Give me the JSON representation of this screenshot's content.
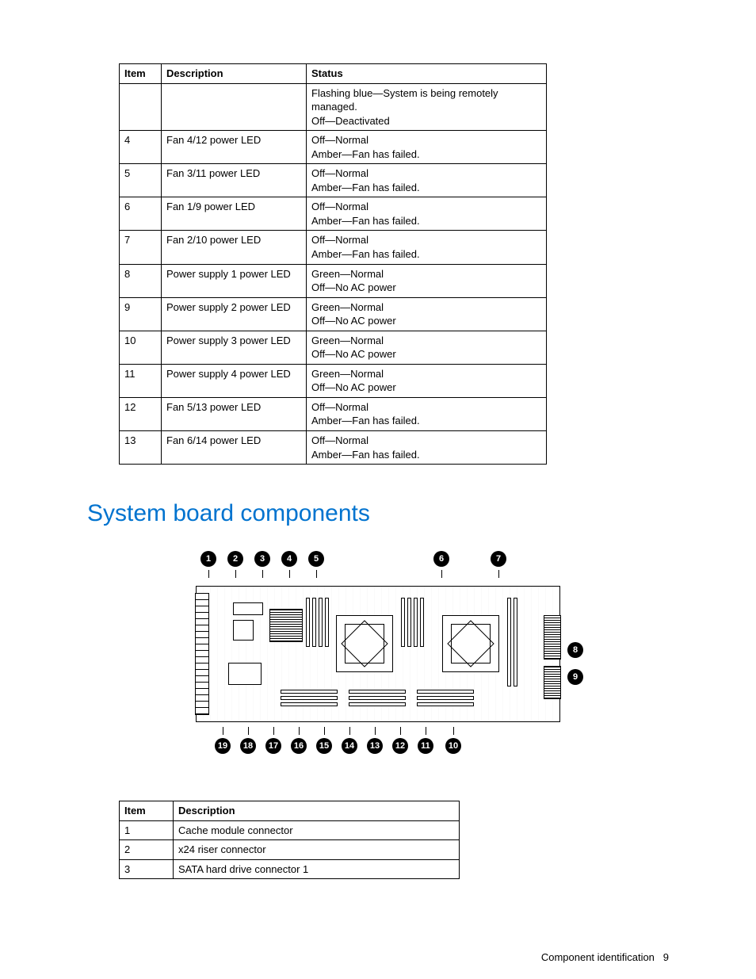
{
  "led_table": {
    "headers": [
      "Item",
      "Description",
      "Status"
    ],
    "rows": [
      {
        "item": "",
        "description": "",
        "status": "Flashing blue—System is being remotely managed.\nOff—Deactivated"
      },
      {
        "item": "4",
        "description": "Fan 4/12 power LED",
        "status": "Off—Normal\nAmber—Fan has failed."
      },
      {
        "item": "5",
        "description": "Fan 3/11 power LED",
        "status": "Off—Normal\nAmber—Fan has failed."
      },
      {
        "item": "6",
        "description": "Fan 1/9 power LED",
        "status": "Off—Normal\nAmber—Fan has failed."
      },
      {
        "item": "7",
        "description": "Fan 2/10 power LED",
        "status": "Off—Normal\nAmber—Fan has failed."
      },
      {
        "item": "8",
        "description": "Power supply 1 power LED",
        "status": "Green—Normal\nOff—No AC power"
      },
      {
        "item": "9",
        "description": "Power supply 2 power LED",
        "status": "Green—Normal\nOff—No AC power"
      },
      {
        "item": "10",
        "description": "Power supply 3 power LED",
        "status": "Green—Normal\nOff—No AC power"
      },
      {
        "item": "11",
        "description": "Power supply 4 power LED",
        "status": "Green—Normal\nOff—No AC power"
      },
      {
        "item": "12",
        "description": "Fan 5/13 power LED",
        "status": "Off—Normal\nAmber—Fan has failed."
      },
      {
        "item": "13",
        "description": "Fan 6/14 power LED",
        "status": "Off—Normal\nAmber—Fan has failed."
      }
    ]
  },
  "section_heading": "System board components",
  "diagram": {
    "top_callouts": [
      "1",
      "2",
      "3",
      "4",
      "5",
      "6",
      "7"
    ],
    "side_callouts": [
      "8",
      "9"
    ],
    "bottom_callouts": [
      "19",
      "18",
      "17",
      "16",
      "15",
      "14",
      "13",
      "12",
      "11",
      "10"
    ]
  },
  "components_table": {
    "headers": [
      "Item",
      "Description"
    ],
    "rows": [
      {
        "item": "1",
        "description": "Cache module connector"
      },
      {
        "item": "2",
        "description": "x24 riser connector"
      },
      {
        "item": "3",
        "description": "SATA hard drive connector 1"
      }
    ]
  },
  "footer": {
    "label": "Component identification",
    "page": "9"
  }
}
